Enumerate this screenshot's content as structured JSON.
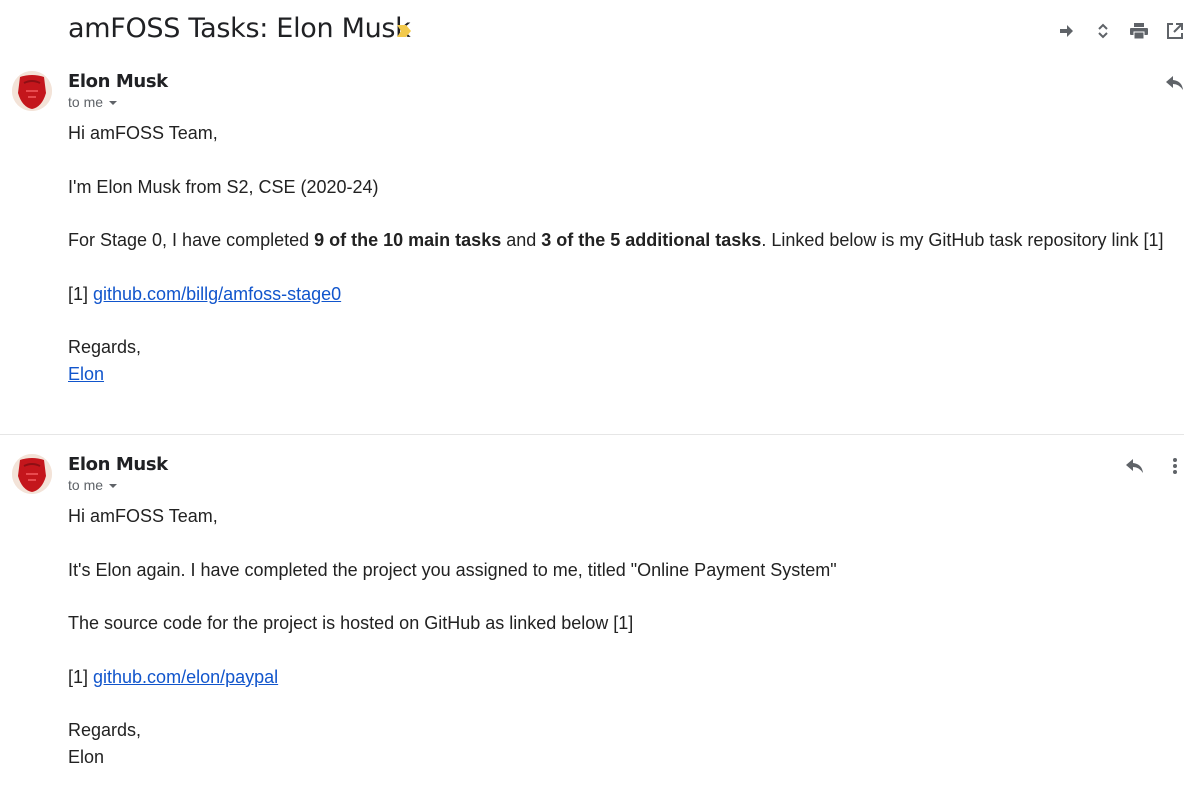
{
  "thread": {
    "subject": "amFOSS Tasks: Elon Musk",
    "label_color": "#f2c94c"
  },
  "toolbar": {
    "icons": [
      "forward-arrow-icon",
      "expand-collapse-icon",
      "print-icon",
      "open-in-new-window-icon"
    ]
  },
  "messages": [
    {
      "sender": "Elon Musk",
      "recipient": "to me",
      "greeting": "Hi amFOSS Team,",
      "line1": "I'm Elon Musk from S2, CSE (2020-24)",
      "line2_a": "For Stage 0, I have completed ",
      "line2_b": "9 of the 10 main tasks",
      "line2_c": " and ",
      "line2_d": "3 of the 5 additional tasks",
      "line2_e": ". Linked below is my GitHub task repository link [1]",
      "ref_prefix": "[1] ",
      "ref_link": "github.com/billg/amfoss-stage0",
      "closing": "Regards,",
      "signature": "Elon"
    },
    {
      "sender": "Elon Musk",
      "recipient": "to me",
      "greeting": "Hi amFOSS Team,",
      "line1": "It's Elon again. I have completed the project you assigned to me, titled \"Online Payment System\"",
      "line2": "The source code for the project is hosted on GitHub as linked below [1]",
      "ref_prefix": "[1] ",
      "ref_link": "github.com/elon/paypal",
      "closing": "Regards,",
      "signature": "Elon"
    }
  ],
  "colors": {
    "link": "#1155cc",
    "muted": "#5f6368",
    "avatar_primary": "#c4161c"
  }
}
